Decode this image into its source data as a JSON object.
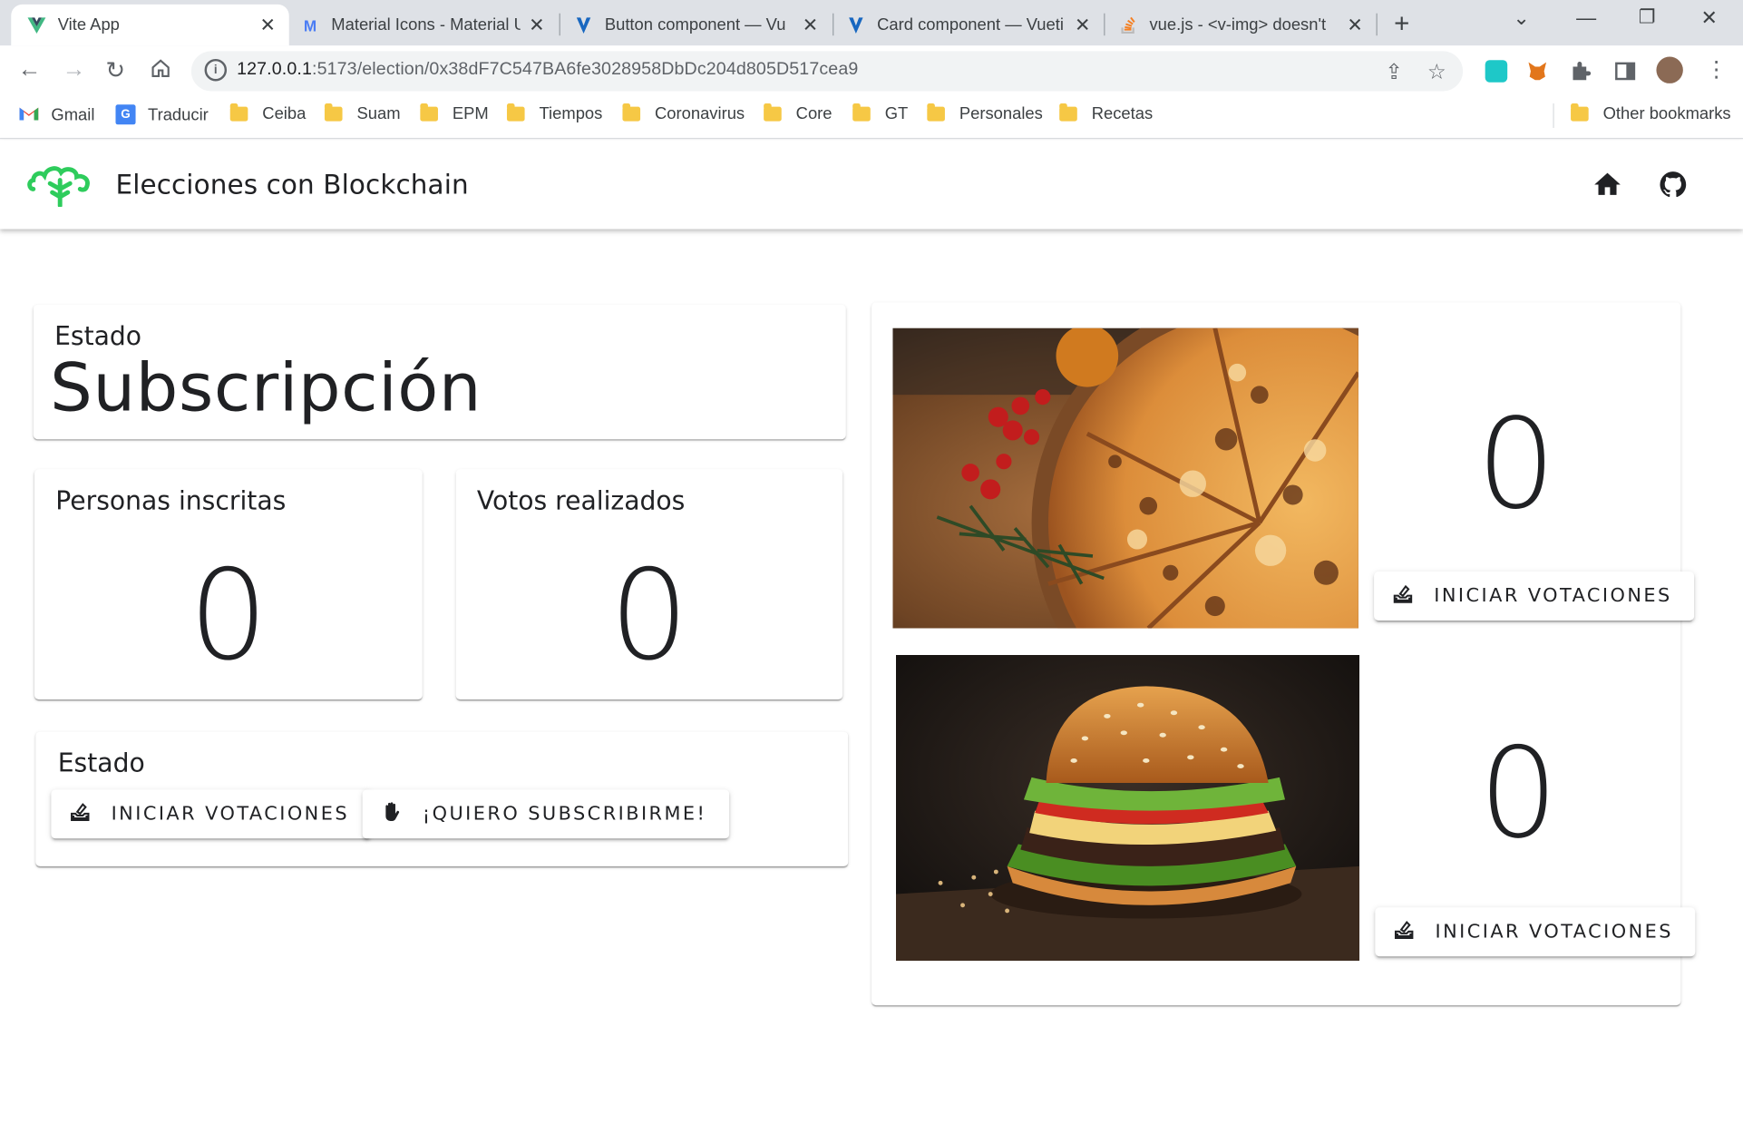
{
  "browser": {
    "tabs": [
      {
        "label": "Vite App",
        "icon": "vite-icon",
        "active": true
      },
      {
        "label": "Material Icons - Material U",
        "icon": "material-icon",
        "active": false
      },
      {
        "label": "Button component — Vu",
        "icon": "vuetify-icon",
        "active": false
      },
      {
        "label": "Card component — Vueti",
        "icon": "vuetify-icon",
        "active": false
      },
      {
        "label": "vue.js - <v-img> doesn't",
        "icon": "stackoverflow-icon",
        "active": false
      }
    ],
    "url_host": "127.0.0.1",
    "url_path": ":5173/election/0x38dF7C547BA6fe3028958DbDc204d805D517cea9",
    "bookmarks": [
      "Gmail",
      "Traducir",
      "Ceiba",
      "Suam",
      "EPM",
      "Tiempos",
      "Coronavirus",
      "Core",
      "GT",
      "Personales",
      "Recetas"
    ],
    "other_bookmarks": "Other bookmarks"
  },
  "app": {
    "title": "Elecciones con Blockchain",
    "accent": "#2ecc5c"
  },
  "status_card": {
    "label": "Estado",
    "value": "Subscripción"
  },
  "stats": {
    "registered_label": "Personas inscritas",
    "registered_value": "0",
    "votes_label": "Votos realizados",
    "votes_value": "0"
  },
  "actions_card": {
    "label": "Estado",
    "start_voting": "INICIAR VOTACIONES",
    "subscribe": "¡QUIERO SUBSCRIBIRME!"
  },
  "candidates": [
    {
      "image": "pizza",
      "votes": "0",
      "button": "INICIAR VOTACIONES"
    },
    {
      "image": "hamburger",
      "votes": "0",
      "button": "INICIAR VOTACIONES"
    }
  ]
}
